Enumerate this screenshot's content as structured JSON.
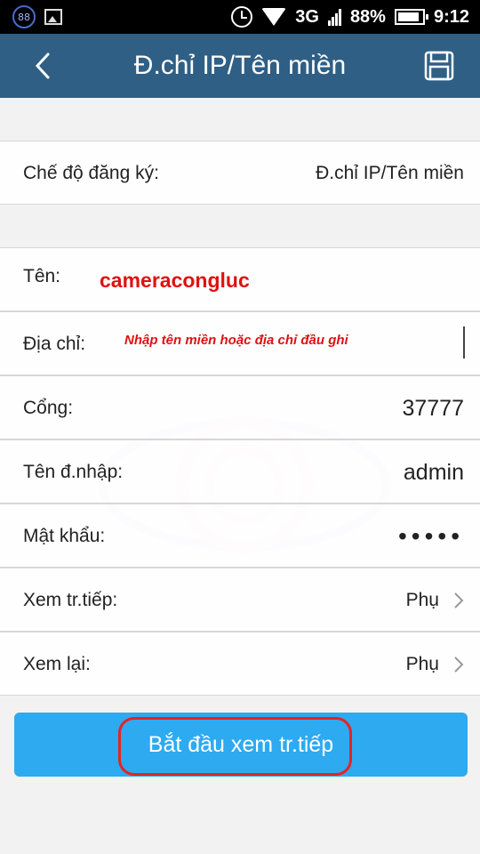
{
  "status_bar": {
    "notification_count": "88",
    "network": "3G",
    "battery": "88%",
    "battery_level": 0.88,
    "time": "9:12"
  },
  "header": {
    "title": "Đ.chỉ IP/Tên miền",
    "back_icon": "back-arrow-icon",
    "save_icon": "save-icon",
    "color": "#2f5f85"
  },
  "form": {
    "registration_mode": {
      "label": "Chế độ đăng ký:",
      "value": "Đ.chỉ IP/Tên miền"
    },
    "name": {
      "label": "Tên:",
      "value": "cameracongluc"
    },
    "address": {
      "label": "Địa chỉ:",
      "hint": "Nhập tên miền hoặc địa chỉ đầu ghi"
    },
    "port": {
      "label": "Cổng:",
      "value": "37777"
    },
    "username": {
      "label": "Tên đ.nhập:",
      "value": "admin"
    },
    "password": {
      "label": "Mật khẩu:",
      "value": "•••••"
    },
    "live_view": {
      "label": "Xem tr.tiếp:",
      "value": "Phụ"
    },
    "playback": {
      "label": "Xem lại:",
      "value": "Phụ"
    }
  },
  "start_button": {
    "label": "Bắt đầu xem tr.tiếp",
    "color": "#2daaf0"
  },
  "annotation_color": "#e01010"
}
